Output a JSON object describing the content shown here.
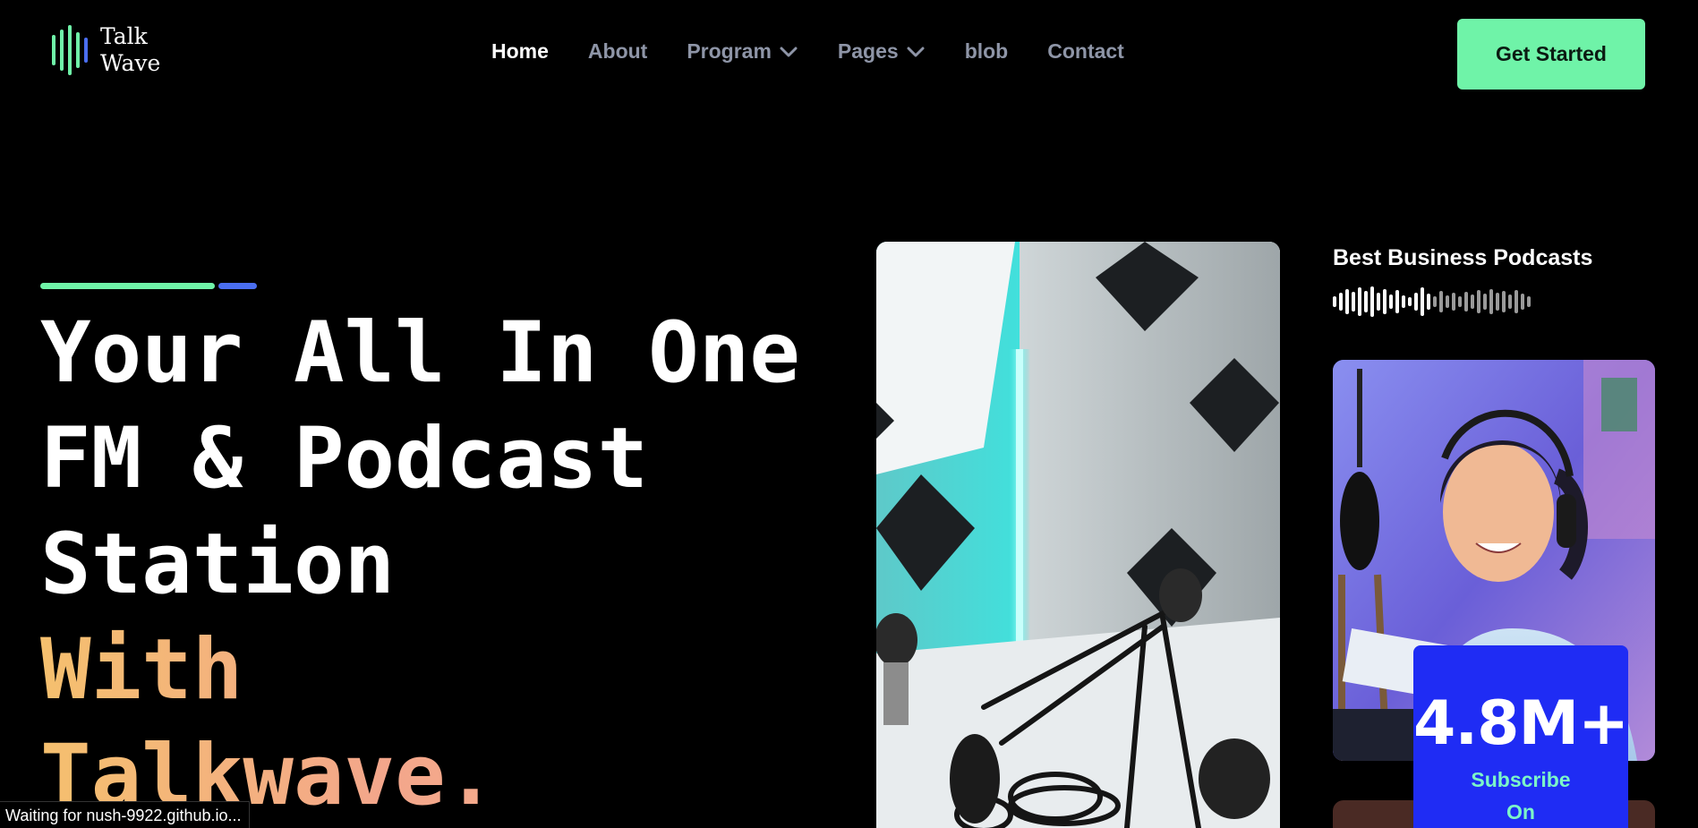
{
  "brand": {
    "name_line1": "Talk",
    "name_line2": "Wave",
    "colors": {
      "mint": "#6ff3a8",
      "blue": "#4a6ef0",
      "stat_bg": "#1f2cf4",
      "stat_label": "#7cf6c8"
    }
  },
  "nav": {
    "items": [
      {
        "label": "Home",
        "active": true,
        "dropdown": false
      },
      {
        "label": "About",
        "active": false,
        "dropdown": false
      },
      {
        "label": "Program",
        "active": false,
        "dropdown": true
      },
      {
        "label": "Pages",
        "active": false,
        "dropdown": true
      },
      {
        "label": "blob",
        "active": false,
        "dropdown": false
      },
      {
        "label": "Contact",
        "active": false,
        "dropdown": false
      }
    ],
    "cta": "Get Started"
  },
  "hero": {
    "line1": "Your All In One",
    "line2": "FM & Podcast",
    "line3": "Station",
    "line4": "With",
    "line5": "Talkwave."
  },
  "side": {
    "title": "Best Business Podcasts",
    "stat_value": "4.8M+",
    "stat_label_line1": "Subscribe",
    "stat_label_line2": "On"
  },
  "status_bar": "Waiting for nush-9922.github.io..."
}
